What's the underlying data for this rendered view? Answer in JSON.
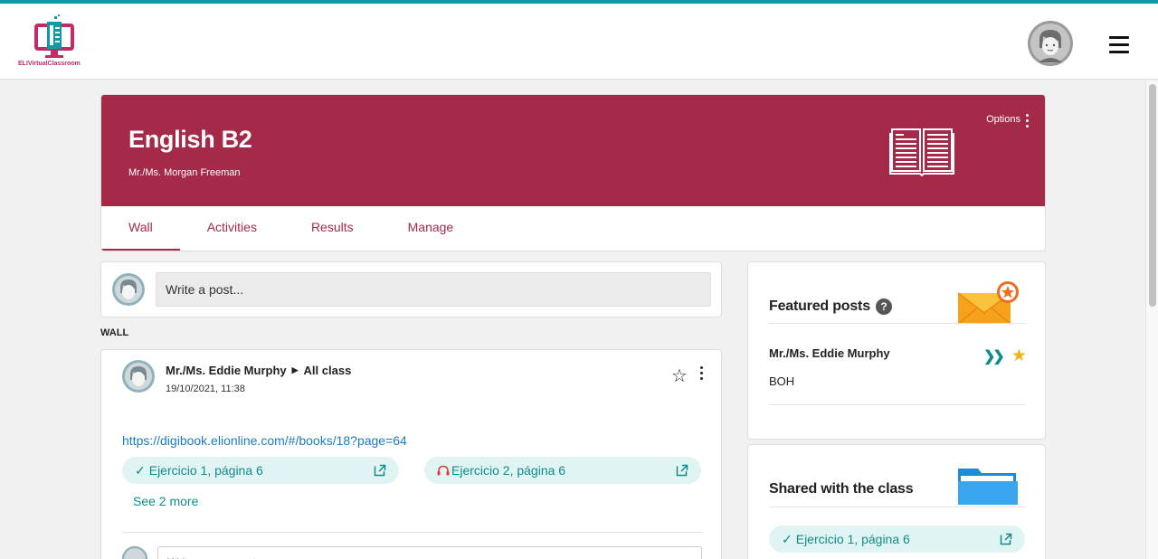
{
  "app": {
    "logo_text": "ELIVirtualClassroom"
  },
  "class": {
    "title": "English B2",
    "teacher": "Mr./Ms. Morgan Freeman",
    "options_label": "Options"
  },
  "tabs": [
    {
      "label": "Wall",
      "active": true
    },
    {
      "label": "Activities",
      "active": false
    },
    {
      "label": "Results",
      "active": false
    },
    {
      "label": "Manage",
      "active": false
    }
  ],
  "composer": {
    "placeholder": "Write a post..."
  },
  "wall": {
    "label": "WALL"
  },
  "post": {
    "author": "Mr./Ms. Eddie Murphy",
    "audience": "All class",
    "date": "19/10/2021, 11:38",
    "link": "https://digibook.elionline.com/#/books/18?page=64",
    "attachments": [
      {
        "label": "Ejercicio 1, página 6",
        "status": "done"
      },
      {
        "label": "Ejercicio 2, página 6",
        "status": "audio"
      }
    ],
    "see_more": "See 2 more",
    "comment_placeholder": "Write a comment..."
  },
  "featured": {
    "title": "Featured posts",
    "items": [
      {
        "author": "Mr./Ms. Eddie Murphy",
        "text": "BOH"
      }
    ]
  },
  "shared": {
    "title": "Shared with the class",
    "items": [
      {
        "label": "Ejercicio 1, página 6"
      }
    ]
  },
  "colors": {
    "brand": "#a52a4a",
    "accent": "#0e9aa7",
    "chip_bg": "#e0f4f3",
    "chip_text": "#138a8a",
    "link": "#1b7bc4",
    "star": "#f5b21b"
  },
  "icons": [
    "logo-icon",
    "avatar-icon",
    "menu-icon",
    "book-icon",
    "kebab-icon",
    "star-outline-icon",
    "check-icon",
    "headphones-icon",
    "external-link-icon",
    "help-icon",
    "envelope-star-icon",
    "double-chevron-icon",
    "star-filled-icon",
    "folder-icon"
  ]
}
